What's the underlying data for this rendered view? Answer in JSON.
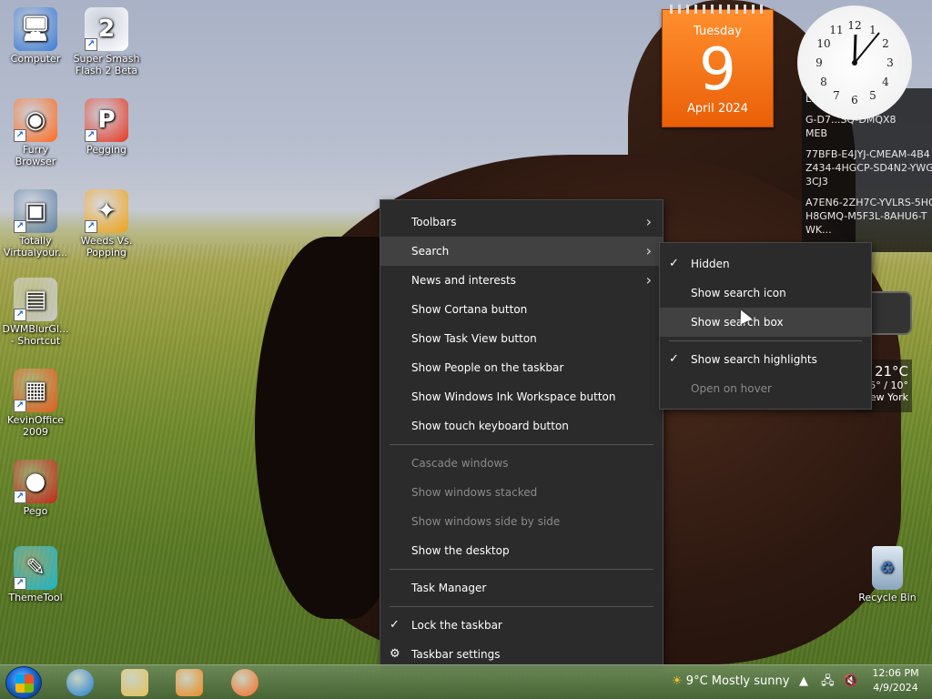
{
  "desktop_icons": [
    {
      "label": "Computer",
      "glyph": "🖥",
      "color": "#3a7bd5"
    },
    {
      "label": "Super Smash Flash 2 Beta",
      "glyph": "2",
      "color": "#ffffff"
    },
    {
      "label": "Furry Browser",
      "glyph": "◉",
      "color": "#ff6a1a"
    },
    {
      "label": "Pegging",
      "glyph": "P",
      "color": "#e8341c"
    },
    {
      "label": "Totally Virtualyour...",
      "glyph": "▣",
      "color": "#5d7fa6"
    },
    {
      "label": "Weeds Vs. Popping",
      "glyph": "✦",
      "color": "#f2a21a"
    },
    {
      "label": "DWMBlurGl... - Shortcut",
      "glyph": "▤",
      "color": "#c9c9c9"
    },
    {
      "label": "KevinOffice 2009",
      "glyph": "▦",
      "color": "#e55a1c"
    },
    {
      "label": "Pego",
      "glyph": "●",
      "color": "#c4261a"
    },
    {
      "label": "ThemeTool",
      "glyph": "✎",
      "color": "#19b6c9"
    }
  ],
  "calendar": {
    "weekday": "Tuesday",
    "day": "9",
    "month_year": "April 2024"
  },
  "product_keys": [
    "L...WY7-R",
    "G-D7...SQ-DMQX8",
    "MEB",
    "77BFB-E4JYJ-CMEAM-4B4",
    "Z434-4HGCP-SD4N2-YWG",
    "3CJ3",
    "A7EN6-2ZH7C-YVLRS-5HG",
    "H8GMQ-M5F3L-8AHU6-T",
    "WK..."
  ],
  "weather_gadget": {
    "temp": "21°C",
    "range": "5° / 10°",
    "city": "New York"
  },
  "recycle_bin": {
    "label": "Recycle Bin"
  },
  "main_menu": {
    "items": [
      {
        "label": "Toolbars",
        "submenu": true,
        "highlighted": false,
        "disabled": false,
        "checked": false
      },
      {
        "label": "Search",
        "submenu": true,
        "highlighted": true,
        "disabled": false,
        "checked": false
      },
      {
        "label": "News and interests",
        "submenu": true,
        "highlighted": false,
        "disabled": false,
        "checked": false
      },
      {
        "label": "Show Cortana button",
        "submenu": false,
        "highlighted": false,
        "disabled": false,
        "checked": false
      },
      {
        "label": "Show Task View button",
        "submenu": false,
        "highlighted": false,
        "disabled": false,
        "checked": false
      },
      {
        "label": "Show People on the taskbar",
        "submenu": false,
        "highlighted": false,
        "disabled": false,
        "checked": false
      },
      {
        "label": "Show Windows Ink Workspace button",
        "submenu": false,
        "highlighted": false,
        "disabled": false,
        "checked": false
      },
      {
        "label": "Show touch keyboard button",
        "submenu": false,
        "highlighted": false,
        "disabled": false,
        "checked": false
      }
    ],
    "window_items": [
      {
        "label": "Cascade windows",
        "disabled": true
      },
      {
        "label": "Show windows stacked",
        "disabled": true
      },
      {
        "label": "Show windows side by side",
        "disabled": true
      },
      {
        "label": "Show the desktop",
        "disabled": false
      }
    ],
    "task_manager": "Task Manager",
    "lock_taskbar": "Lock the taskbar",
    "taskbar_settings": "Taskbar settings"
  },
  "search_submenu": {
    "items": [
      {
        "label": "Hidden",
        "checked": true,
        "highlighted": false,
        "disabled": false
      },
      {
        "label": "Show search icon",
        "checked": false,
        "highlighted": false,
        "disabled": false
      },
      {
        "label": "Show search box",
        "checked": false,
        "highlighted": true,
        "disabled": false
      }
    ],
    "options": [
      {
        "label": "Show search highlights",
        "checked": true,
        "disabled": false
      },
      {
        "label": "Open on hover",
        "checked": false,
        "disabled": true
      }
    ]
  },
  "taskbar": {
    "weather": "9°C  Mostly sunny",
    "time": "12:06 PM",
    "date": "4/9/2024",
    "pinned": [
      {
        "name": "internet-explorer",
        "color": "#1e7fd8"
      },
      {
        "name": "file-explorer",
        "color": "#e9c257"
      },
      {
        "name": "media-player",
        "color": "#f18a1c"
      },
      {
        "name": "firefox",
        "color": "#ff6a1a"
      }
    ]
  }
}
